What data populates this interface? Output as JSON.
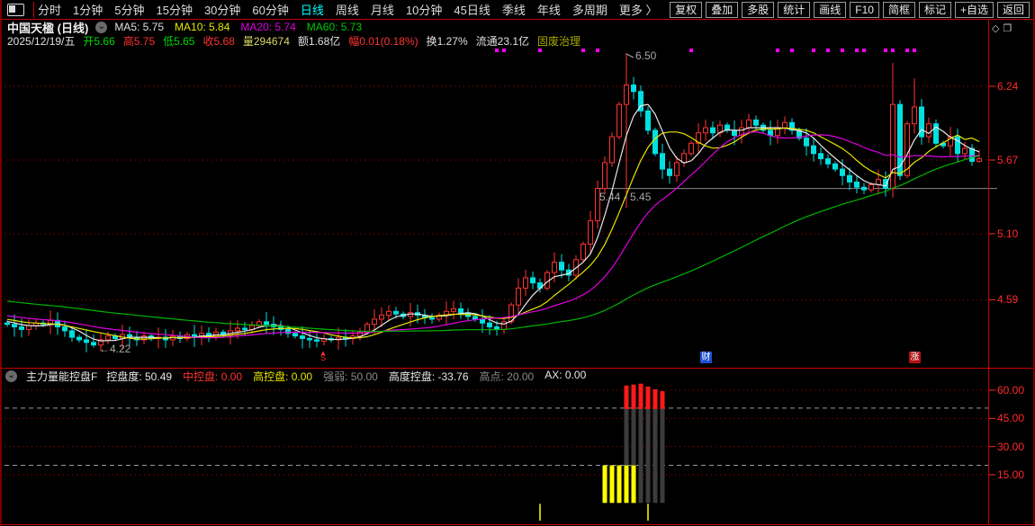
{
  "top_menu": {
    "periods": [
      "分时",
      "1分钟",
      "5分钟",
      "15分钟",
      "30分钟",
      "60分钟",
      "日线",
      "周线",
      "月线",
      "10分钟",
      "45日线",
      "季线",
      "年线",
      "多周期",
      "更多 〉"
    ],
    "active_period": "日线",
    "right_buttons": [
      "复权",
      "叠加",
      "多股",
      "统计",
      "画线",
      "F10",
      "简框",
      "标记",
      "+自选",
      "返回"
    ]
  },
  "header": {
    "title": "中国天楹",
    "period_label": "(日线)",
    "ma_values": [
      {
        "text": "MA5: 5.75",
        "color": "#e0e0e0"
      },
      {
        "text": "MA10: 5.84",
        "color": "#e6e600"
      },
      {
        "text": "MA20: 5.74",
        "color": "#e000e0"
      },
      {
        "text": "MA60: 5.73",
        "color": "#00c800"
      }
    ],
    "quote_info": [
      {
        "text": "2025/12/19/五",
        "color": "#e0e0e0"
      },
      {
        "text": "开5.66",
        "color": "#00d800"
      },
      {
        "text": "高5.75",
        "color": "#ff3232"
      },
      {
        "text": "低5.65",
        "color": "#00d800"
      },
      {
        "text": "收5.68",
        "color": "#ff3232"
      },
      {
        "text": "量294674",
        "color": "#d8d86a"
      },
      {
        "text": "额1.68亿",
        "color": "#e0e0e0"
      },
      {
        "text": "幅0.01(0.18%)",
        "color": "#ff3232"
      },
      {
        "text": "换1.27%",
        "color": "#e0e0e0"
      },
      {
        "text": "流通23.1亿",
        "color": "#e0e0e0"
      },
      {
        "text": "固废治理",
        "color": "#a8a800"
      }
    ]
  },
  "corner_icons": [
    "◇",
    "❐"
  ],
  "panel2_header": {
    "title": "主力量能控盘F",
    "values": [
      {
        "text": "控盘度: 50.49",
        "color": "#e8e8e8"
      },
      {
        "text": "中控盘: 0.00",
        "color": "#ff3232"
      },
      {
        "text": "高控盘: 0.00",
        "color": "#e6e600"
      },
      {
        "text": "强弱: 50.00",
        "color": "#8a8a8a"
      },
      {
        "text": "高度控盘: -33.76",
        "color": "#e8e8e8"
      },
      {
        "text": "高点: 20.00",
        "color": "#8a8a8a"
      },
      {
        "text": "AX: 0.00",
        "color": "#e8e8e8"
      }
    ]
  },
  "colors": {
    "up": "#ff3232",
    "down": "#00e0e0",
    "grid": "#bb0000",
    "axis_text": "#ff2a2a",
    "frame": "#c80000",
    "gray_ref": "#999999",
    "dot": "#ff00ff",
    "ma5": "#e8e8e8",
    "ma10": "#e6e600",
    "ma20": "#e000e0",
    "ma60": "#00b400",
    "bar_gray": "#3c3c3c",
    "bar_red": "#ff1a1a",
    "bar_yellow": "#ffff00"
  },
  "chart_data": [
    {
      "type": "candlestick",
      "title": "中国天楹 日线",
      "y_axis_ticks": [
        "6.24",
        "5.67",
        "5.10",
        "4.59"
      ],
      "closes": [
        4.4,
        4.38,
        4.36,
        4.39,
        4.41,
        4.4,
        4.43,
        4.38,
        4.35,
        4.3,
        4.28,
        4.26,
        4.24,
        4.28,
        4.31,
        4.29,
        4.32,
        4.3,
        4.28,
        4.31,
        4.29,
        4.3,
        4.28,
        4.31,
        4.29,
        4.32,
        4.3,
        4.33,
        4.31,
        4.34,
        4.32,
        4.35,
        4.37,
        4.36,
        4.39,
        4.42,
        4.4,
        4.38,
        4.36,
        4.33,
        4.31,
        4.29,
        4.28,
        4.27,
        4.29,
        4.28,
        4.3,
        4.29,
        4.31,
        4.34,
        4.4,
        4.44,
        4.47,
        4.5,
        4.48,
        4.46,
        4.49,
        4.47,
        4.45,
        4.44,
        4.47,
        4.5,
        4.52,
        4.49,
        4.46,
        4.44,
        4.41,
        4.38,
        4.36,
        4.42,
        4.55,
        4.68,
        4.76,
        4.72,
        4.68,
        4.8,
        4.88,
        4.82,
        4.78,
        4.9,
        5.02,
        5.2,
        5.45,
        5.65,
        5.85,
        6.1,
        6.25,
        6.2,
        6.05,
        5.9,
        5.72,
        5.6,
        5.55,
        5.65,
        5.72,
        5.8,
        5.88,
        5.92,
        5.88,
        5.94,
        5.9,
        5.86,
        5.92,
        5.98,
        5.94,
        5.9,
        5.86,
        5.92,
        5.96,
        5.9,
        5.84,
        5.78,
        5.72,
        5.68,
        5.64,
        5.6,
        5.55,
        5.5,
        5.46,
        5.44,
        5.48,
        5.52,
        5.45,
        6.1,
        5.55,
        5.95,
        6.08,
        5.85,
        5.95,
        5.8,
        5.78,
        5.85,
        5.72,
        5.76,
        5.66,
        5.68
      ],
      "overrides": {
        "12": {
          "low": 4.22
        },
        "86": {
          "high": 6.5,
          "low": 5.3
        },
        "123": {
          "high": 6.42,
          "low": 5.38
        },
        "126": {
          "high": 6.3
        },
        "135": {
          "open": 5.66,
          "high": 5.75,
          "low": 5.65,
          "close": 5.68
        }
      },
      "ma_lines": [
        {
          "name": "MA5",
          "period": 5,
          "last_value": 5.75
        },
        {
          "name": "MA10",
          "period": 10,
          "last_value": 5.84
        },
        {
          "name": "MA20",
          "period": 20,
          "last_value": 5.74
        },
        {
          "name": "MA60",
          "period": 60,
          "last_value": 5.73
        }
      ],
      "ma_warmup": {
        "len": 60,
        "start": 4.75,
        "end": 4.42
      },
      "high_marker": {
        "label": "6.50",
        "candle_index": 86
      },
      "low_marker": {
        "label": "4.22",
        "candle_index": 12
      },
      "ref_line": {
        "label": "5.44 - 5.45",
        "value": 5.45,
        "from_index": 82
      },
      "signal_marker": {
        "label": "S",
        "candle_index": 44
      },
      "event_badges": [
        {
          "label": "财",
          "candle_index": 97,
          "bg": "#1e4fd0"
        },
        {
          "label": "涨",
          "candle_index": 126,
          "bg": "#b01212"
        }
      ],
      "dot_marker_indices": [
        68,
        69,
        74,
        80,
        82,
        95,
        107,
        109,
        112,
        114,
        116,
        118,
        119,
        122,
        123,
        125,
        126
      ]
    },
    {
      "type": "bar",
      "title": "主力量能控盘F",
      "y_axis_ticks": [
        "60.00",
        "45.00",
        "30.00",
        "15.00"
      ],
      "y_tick_values": [
        60,
        45,
        30,
        15
      ],
      "gray_ref_lines": [
        50.49,
        20.0
      ],
      "yellow_bars": {
        "indices": [
          83,
          84,
          85,
          86,
          87
        ],
        "value": 20
      },
      "gray_bars": {
        "indices": [
          86,
          87,
          88,
          89,
          90,
          91
        ],
        "value": 50
      },
      "red_caps": {
        "indices": [
          86,
          87,
          88,
          89,
          90,
          91
        ],
        "values": [
          62.5,
          63,
          63.5,
          62,
          60.5,
          59.5
        ]
      },
      "neg_spikes": {
        "indices": [
          74,
          89
        ],
        "value": -9
      }
    }
  ]
}
